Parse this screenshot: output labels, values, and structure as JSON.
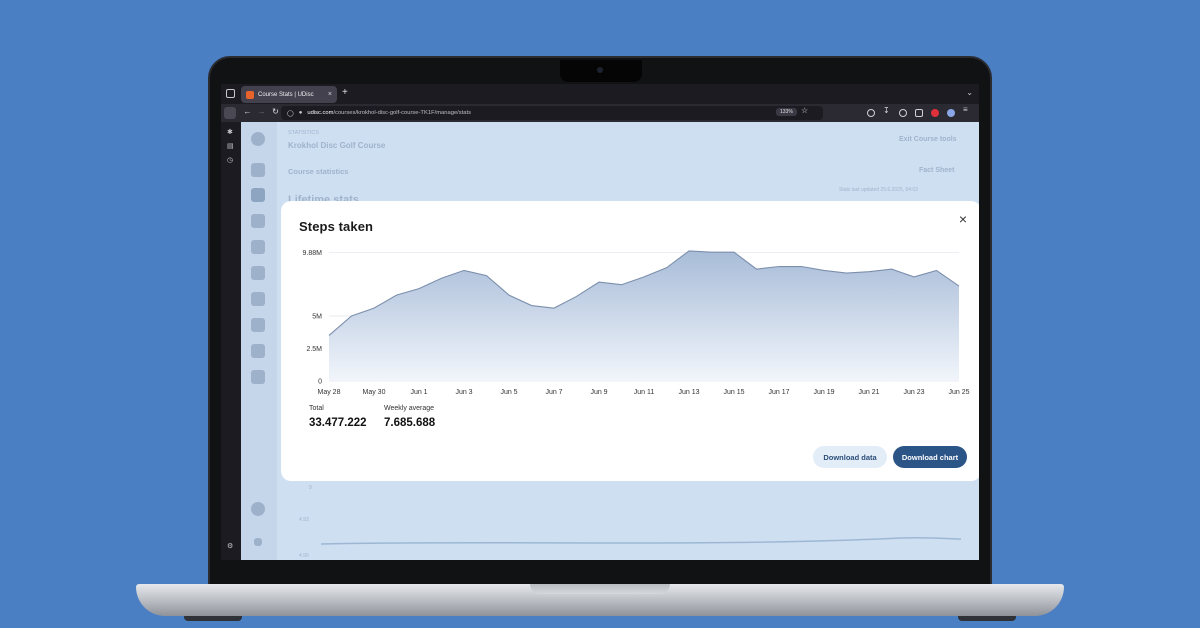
{
  "browser": {
    "tab_title": "Course Stats | UDisc",
    "tab_close": "×",
    "new_tab": "+",
    "url_domain": "udisc.com",
    "url_path": "/courses/krokhol-disc-golf-course-TK1F/manage/stats",
    "zoom": "133%"
  },
  "background_page": {
    "section": "STATISTICS",
    "course_name": "Krokhol Disc Golf Course",
    "exit_tools": "Exit Course tools",
    "course_statistics": "Course statistics",
    "fact_sheet": "Fact Sheet",
    "last_updated": "Stats last updated 25.6.2025, 04:03",
    "lifetime_partial": "Lifetime stats",
    "bg_axis_1": "9",
    "bg_axis_2": "4.93",
    "bg_axis_3": "4.90"
  },
  "modal": {
    "title": "Steps taken",
    "close_icon": "×",
    "total_label": "Total",
    "total_value": "33.477.222",
    "weekly_label": "Weekly average",
    "weekly_value": "7.685.688",
    "download_data": "Download data",
    "download_chart": "Download chart"
  },
  "chart_data": {
    "type": "area",
    "x": [
      "May 28",
      "May 29",
      "May 30",
      "May 31",
      "Jun 1",
      "Jun 2",
      "Jun 3",
      "Jun 4",
      "Jun 5",
      "Jun 6",
      "Jun 7",
      "Jun 8",
      "Jun 9",
      "Jun 10",
      "Jun 11",
      "Jun 12",
      "Jun 13",
      "Jun 14",
      "Jun 15",
      "Jun 16",
      "Jun 17",
      "Jun 18",
      "Jun 19",
      "Jun 20",
      "Jun 21",
      "Jun 22",
      "Jun 23",
      "Jun 24",
      "Jun 25"
    ],
    "values": [
      3.5,
      5.0,
      5.6,
      6.6,
      7.1,
      7.9,
      8.5,
      8.1,
      6.6,
      5.8,
      5.6,
      6.5,
      7.6,
      7.4,
      8.0,
      8.7,
      10.0,
      9.9,
      9.9,
      8.6,
      8.8,
      8.8,
      8.5,
      8.3,
      8.4,
      8.6,
      8.0,
      8.5,
      7.3
    ],
    "unit": "M",
    "x_tick_labels": [
      "May 28",
      "May 30",
      "Jun 1",
      "Jun 3",
      "Jun 5",
      "Jun 7",
      "Jun 9",
      "Jun 11",
      "Jun 13",
      "Jun 15",
      "Jun 17",
      "Jun 19",
      "Jun 21",
      "Jun 23",
      "Jun 25"
    ],
    "y_ticks": [
      {
        "value": 0,
        "label": "0"
      },
      {
        "value": 2.5,
        "label": "2.5M"
      },
      {
        "value": 5,
        "label": "5M"
      },
      {
        "value": 9.88,
        "label": "9.88M"
      }
    ],
    "ylim": [
      0,
      10.3
    ],
    "grid": true,
    "line_color": "#7b8fac",
    "fill_top": "#a8bcd8",
    "fill_bottom": "#f1f5fb"
  }
}
